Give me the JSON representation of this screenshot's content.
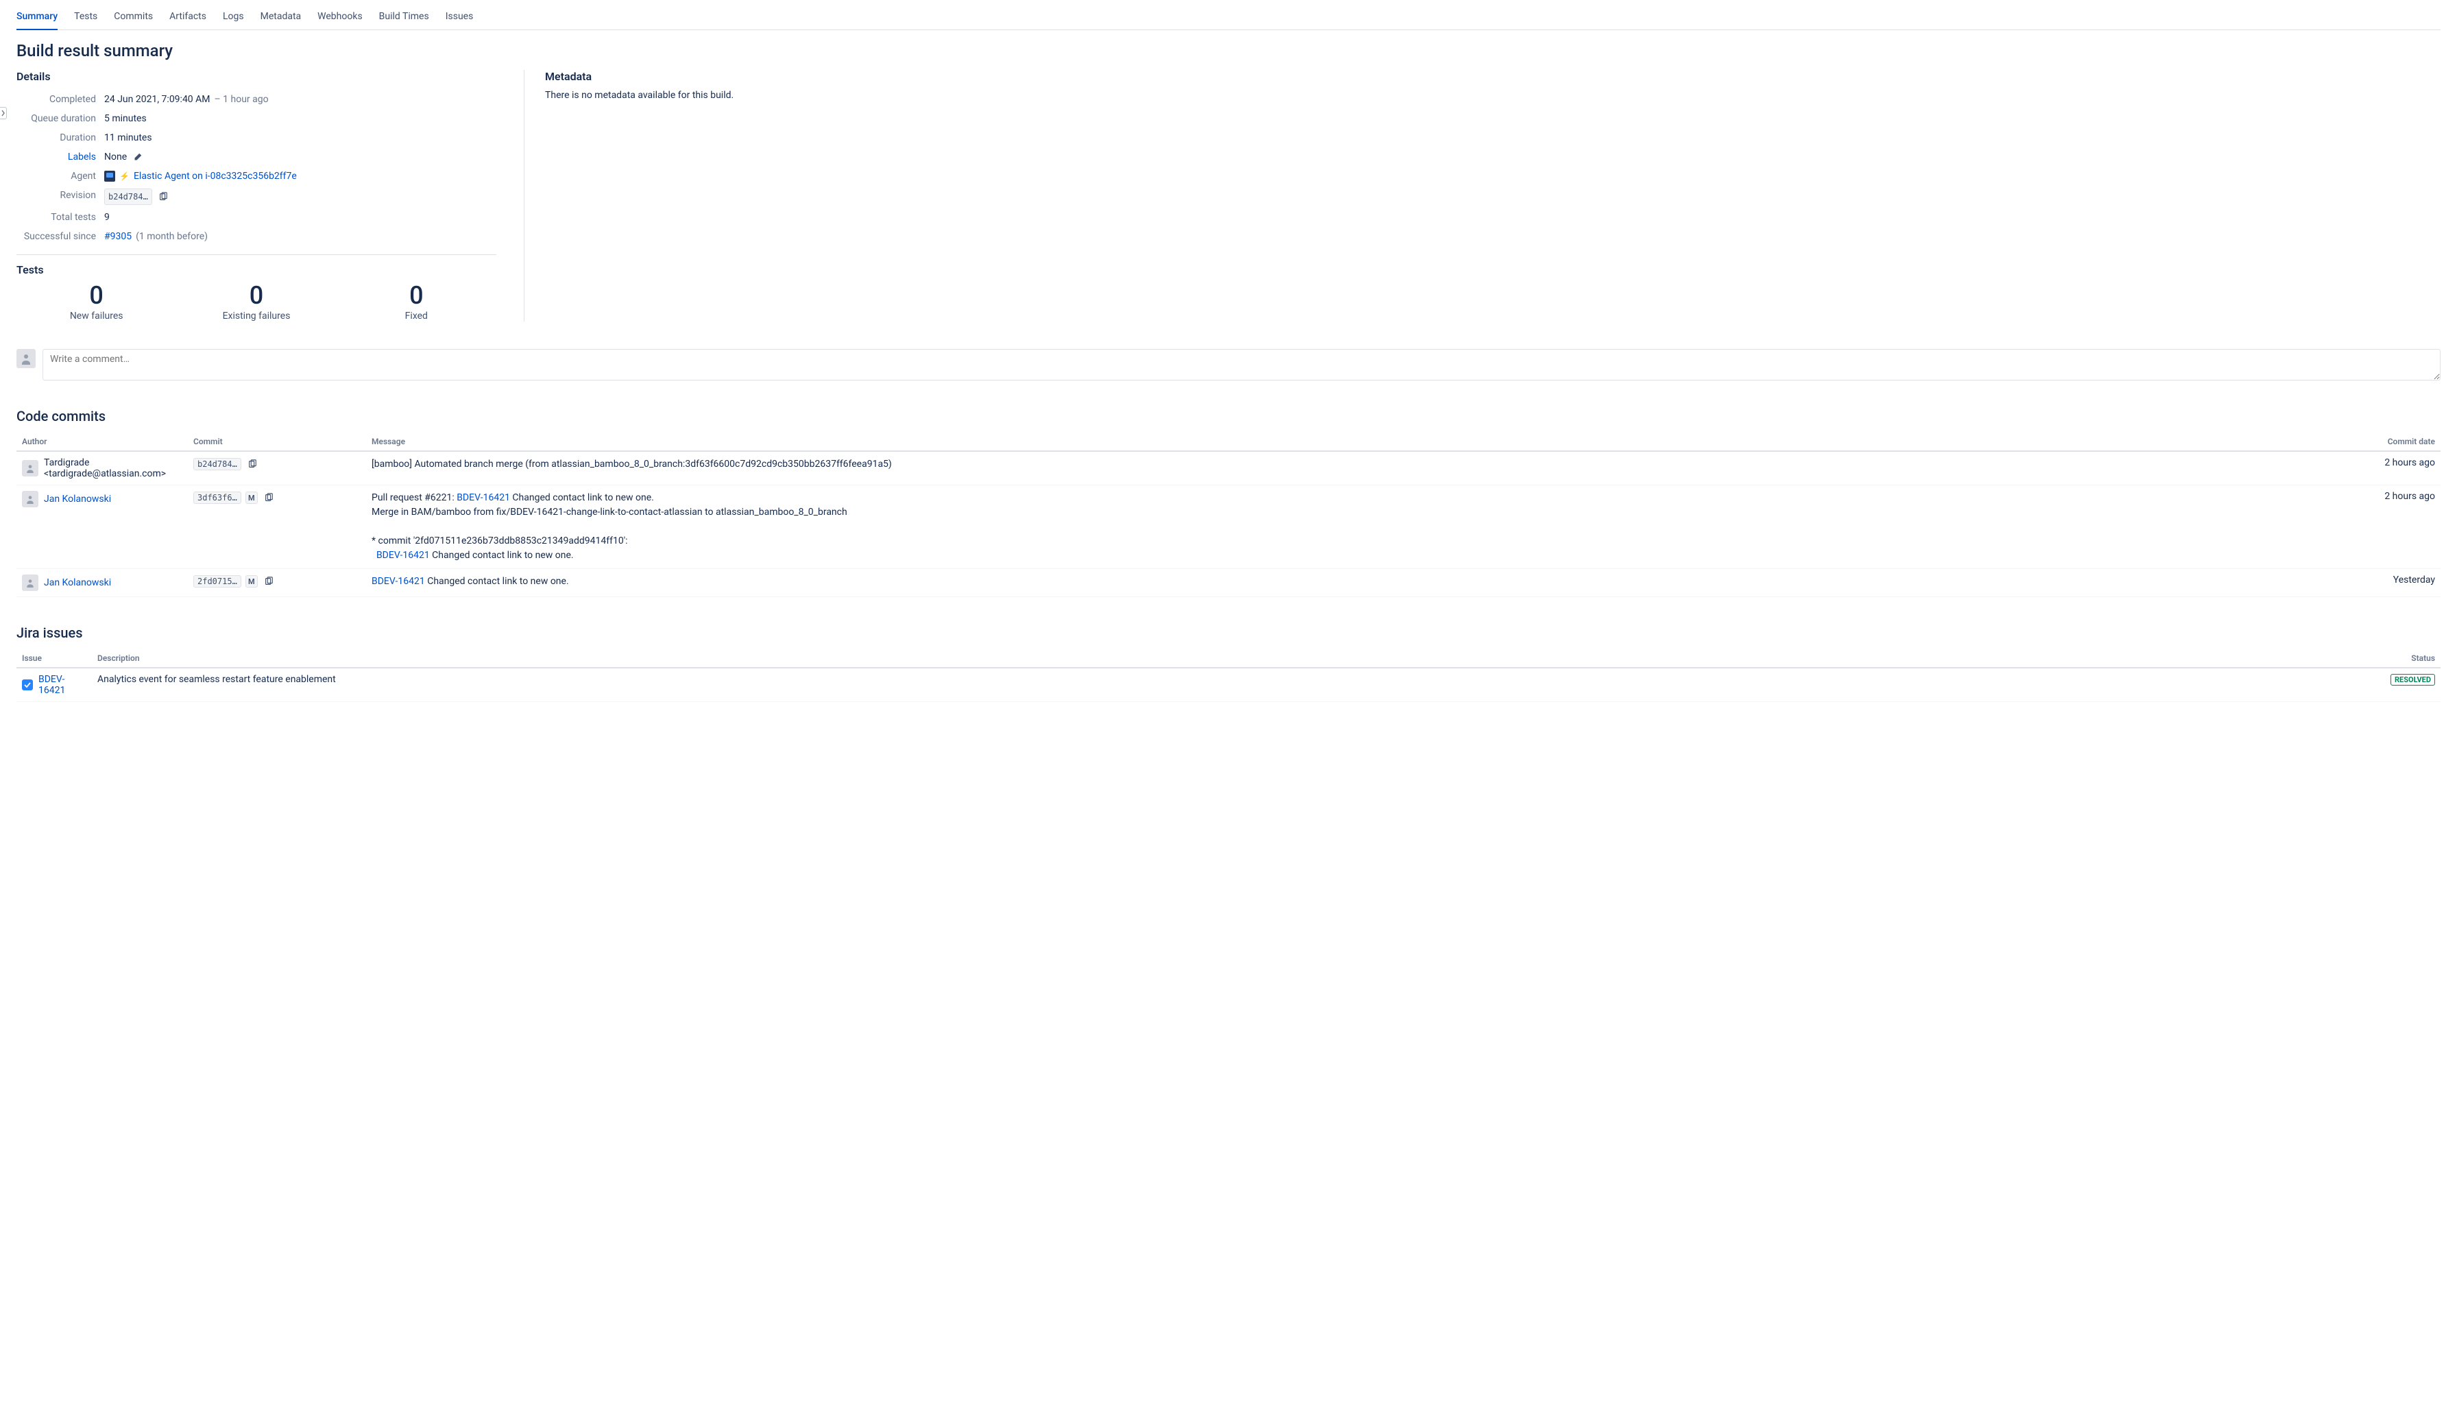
{
  "tabs": [
    "Summary",
    "Tests",
    "Commits",
    "Artifacts",
    "Logs",
    "Metadata",
    "Webhooks",
    "Build Times",
    "Issues"
  ],
  "active_tab": "Summary",
  "page_title": "Build result summary",
  "details": {
    "heading": "Details",
    "labels": {
      "completed": "Completed",
      "queue_duration": "Queue duration",
      "duration": "Duration",
      "labels": "Labels",
      "agent": "Agent",
      "revision": "Revision",
      "total_tests": "Total tests",
      "successful_since": "Successful since"
    },
    "completed_value": "24 Jun 2021, 7:09:40 AM",
    "completed_rel": "– 1 hour ago",
    "queue_duration_value": "5 minutes",
    "duration_value": "11 minutes",
    "labels_value": "None",
    "agent_value": "Elastic Agent on i-08c3325c356b2ff7e",
    "revision_value": "b24d784…",
    "total_tests_value": "9",
    "successful_since_link": "#9305",
    "successful_since_rel": "(1 month before)"
  },
  "metadata": {
    "heading": "Metadata",
    "empty_text": "There is no metadata available for this build."
  },
  "tests": {
    "heading": "Tests",
    "stats": [
      {
        "num": "0",
        "label": "New failures"
      },
      {
        "num": "0",
        "label": "Existing failures"
      },
      {
        "num": "0",
        "label": "Fixed"
      }
    ]
  },
  "comment_placeholder": "Write a comment…",
  "commits": {
    "heading": "Code commits",
    "columns": {
      "author": "Author",
      "commit": "Commit",
      "message": "Message",
      "date": "Commit date"
    },
    "rows": [
      {
        "author": "Tardigrade <tardigrade@atlassian.com>",
        "author_link": false,
        "hash": "b24d784…",
        "merge": false,
        "message_pre": "[bamboo] Automated branch merge (from atlassian_bamboo_8_0_branch:3df63f6600c7d92cd9cb350bb2637ff6feea91a5)",
        "date": "2 hours ago"
      },
      {
        "author": "Jan Kolanowski",
        "author_link": true,
        "hash": "3df63f6…",
        "merge": true,
        "message_pre": "Pull request #6221: ",
        "message_issue": "BDEV-16421",
        "message_post": " Changed contact link to new one.",
        "extra1": "Merge in BAM/bamboo from fix/BDEV-16421-change-link-to-contact-atlassian to atlassian_bamboo_8_0_branch",
        "extra2": "* commit '2fd071511e236b73ddb8853c21349add9414ff10':",
        "extra3_issue": "BDEV-16421",
        "extra3_post": " Changed contact link to new one.",
        "date": "2 hours ago"
      },
      {
        "author": "Jan Kolanowski",
        "author_link": true,
        "hash": "2fd0715…",
        "merge": true,
        "message_issue": "BDEV-16421",
        "message_post": " Changed contact link to new one.",
        "date": "Yesterday"
      }
    ]
  },
  "jira": {
    "heading": "Jira issues",
    "columns": {
      "issue": "Issue",
      "description": "Description",
      "status": "Status"
    },
    "rows": [
      {
        "key": "BDEV-16421",
        "description": "Analytics event for seamless restart feature enablement",
        "status": "RESOLVED"
      }
    ]
  }
}
